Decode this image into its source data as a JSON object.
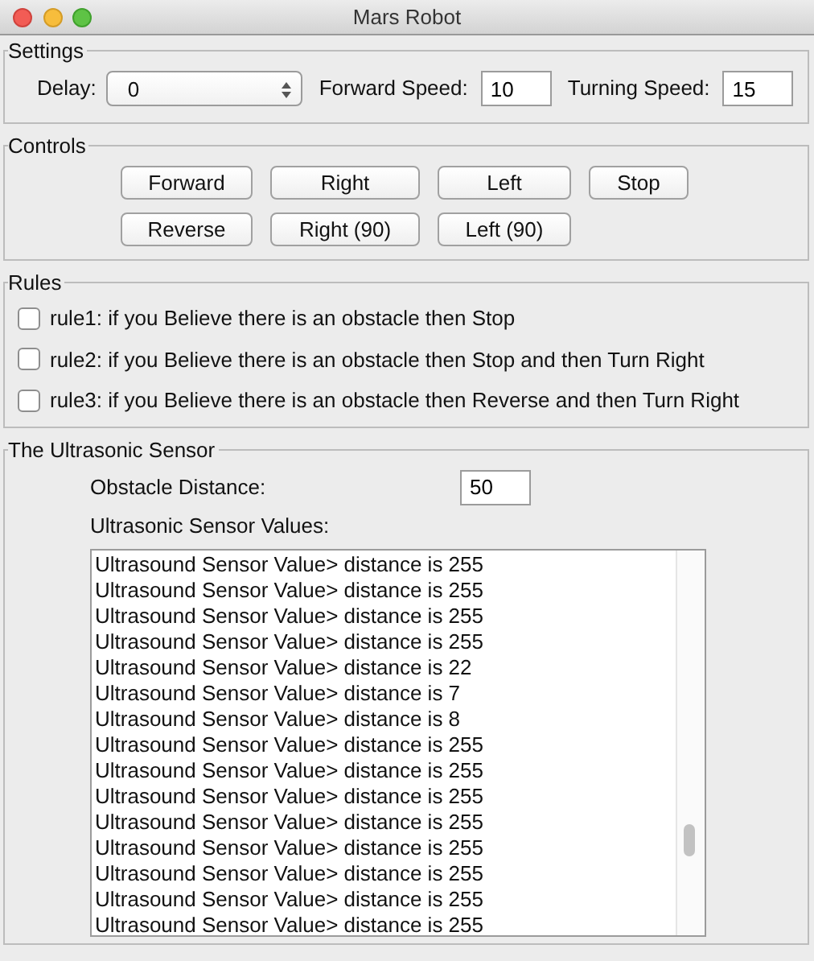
{
  "window": {
    "title": "Mars Robot"
  },
  "settings": {
    "title": "Settings",
    "delay": {
      "label": "Delay:",
      "value": "0"
    },
    "forward_speed": {
      "label": "Forward Speed:",
      "value": "10"
    },
    "turning_speed": {
      "label": "Turning Speed:",
      "value": "15"
    }
  },
  "controls": {
    "title": "Controls",
    "rows": [
      [
        "Forward",
        "Right",
        "Left",
        "Stop"
      ],
      [
        "Reverse",
        "Right (90)",
        "Left (90)"
      ]
    ]
  },
  "rules": {
    "title": "Rules",
    "items": [
      {
        "label": "rule1: if you Believe there is an obstacle then Stop",
        "checked": false
      },
      {
        "label": "rule2: if you Believe there is an obstacle then Stop and then Turn Right",
        "checked": false
      },
      {
        "label": "rule3: if you Believe there is an obstacle then Reverse and then Turn Right",
        "checked": false
      }
    ]
  },
  "sensor": {
    "title": "The Ultrasonic Sensor",
    "obstacle_distance": {
      "label": "Obstacle Distance:",
      "value": "50"
    },
    "values_label": "Ultrasonic Sensor Values:",
    "log": [
      "Ultrasound Sensor Value> distance is 255",
      "Ultrasound Sensor Value> distance is 255",
      "Ultrasound Sensor Value> distance is 255",
      "Ultrasound Sensor Value> distance is 255",
      "Ultrasound Sensor Value> distance is 22",
      "Ultrasound Sensor Value> distance is 7",
      "Ultrasound Sensor Value> distance is 8",
      "Ultrasound Sensor Value> distance is 255",
      "Ultrasound Sensor Value> distance is 255",
      "Ultrasound Sensor Value> distance is 255",
      "Ultrasound Sensor Value> distance is 255",
      "Ultrasound Sensor Value> distance is 255",
      "Ultrasound Sensor Value> distance is 255",
      "Ultrasound Sensor Value> distance is 255",
      "Ultrasound Sensor Value> distance is 255"
    ]
  }
}
